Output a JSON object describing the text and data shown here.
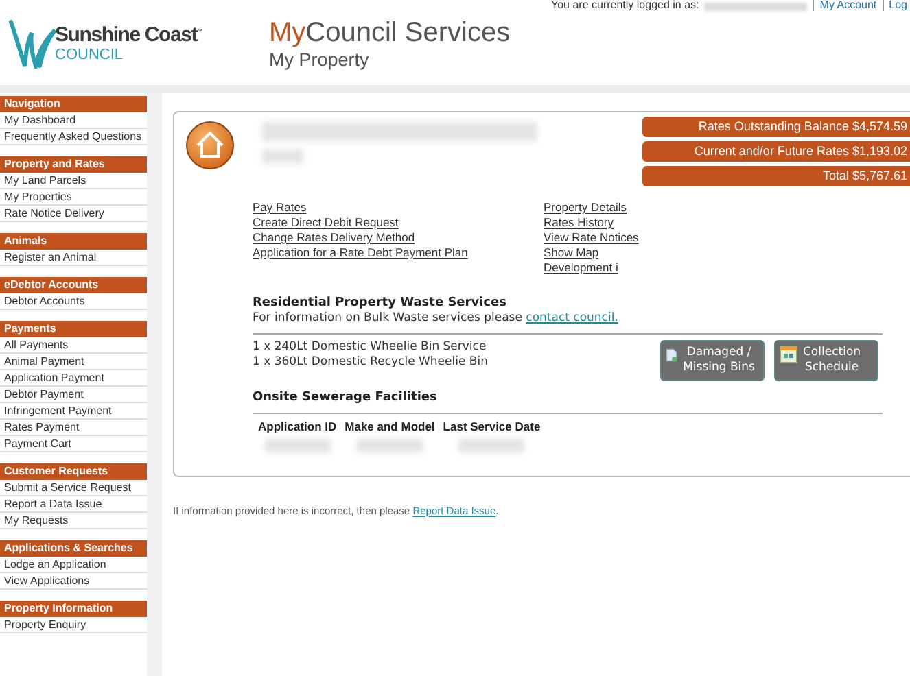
{
  "top_bar": {
    "text": "You are currently logged in as:",
    "links": [
      "My Account",
      "Log"
    ]
  },
  "header": {
    "logo_name": "Sunshine Coast",
    "logo_tm": "™",
    "logo_sub": "COUNCIL",
    "title_prefix": "My",
    "title": "Council Services",
    "subtitle": "My Property"
  },
  "sidebar": {
    "sections": [
      {
        "title": "Navigation",
        "items": [
          "My Dashboard",
          "Frequently Asked Questions"
        ]
      },
      {
        "title": "Property and Rates",
        "items": [
          "My Land Parcels",
          "My Properties",
          "Rate Notice Delivery"
        ]
      },
      {
        "title": "Animals",
        "items": [
          "Register an Animal"
        ]
      },
      {
        "title": "eDebtor Accounts",
        "items": [
          "Debtor Accounts"
        ]
      },
      {
        "title": "Payments",
        "items": [
          "All Payments",
          "Animal Payment",
          "Application Payment",
          "Debtor Payment",
          "Infringement Payment",
          "Rates Payment",
          "Payment Cart"
        ]
      },
      {
        "title": "Customer Requests",
        "items": [
          "Submit a Service Request",
          "Report a Data Issue",
          "My Requests"
        ]
      },
      {
        "title": "Applications & Searches",
        "items": [
          "Lodge an Application",
          "View Applications"
        ]
      },
      {
        "title": "Property Information",
        "items": [
          "Property Enquiry"
        ]
      }
    ]
  },
  "property": {
    "balances": [
      "Rates Outstanding Balance $4,574.59",
      "Current and/or Future Rates $1,193.02",
      "Total $5,767.61"
    ],
    "links_left": [
      "Pay Rates",
      "Create Direct Debit Request",
      "Change Rates Delivery Method",
      "Application for a Rate Debt Payment Plan"
    ],
    "links_right": [
      "Property Details",
      "Rates History",
      "View Rate Notices",
      "Show Map",
      "Development i"
    ],
    "waste": {
      "heading": "Residential Property Waste Services",
      "info_text": "For information on Bulk Waste services please",
      "info_link": "contact council.",
      "services": [
        "1 x 240Lt Domestic Wheelie Bin Service",
        "1 x 360Lt Domestic Recycle Wheelie Bin"
      ],
      "buttons": [
        {
          "kind": "report",
          "lines": [
            "Damaged /",
            "Missing Bins"
          ]
        },
        {
          "kind": "schedule",
          "lines": [
            "Collection",
            "Schedule"
          ]
        }
      ]
    },
    "sewerage": {
      "heading": "Onsite Sewerage Facilities",
      "columns": [
        "Application ID",
        "Make and Model",
        "Last Service Date"
      ]
    }
  },
  "footer_note": {
    "text": "If information provided here is incorrect, then please",
    "link": "Report Data Issue",
    "end": "."
  }
}
